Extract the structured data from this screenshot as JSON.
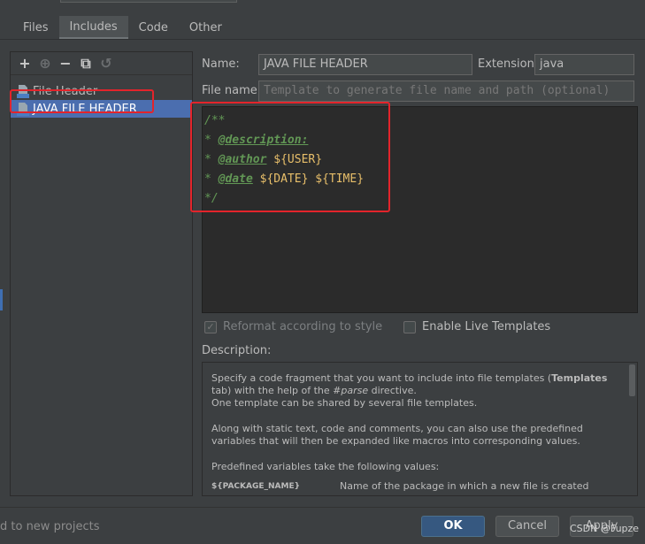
{
  "tabs": [
    {
      "label": "Files"
    },
    {
      "label": "Includes"
    },
    {
      "label": "Code"
    },
    {
      "label": "Other"
    }
  ],
  "toolbar": {
    "add": "+",
    "add_child": "⊕",
    "remove": "−",
    "copy": "⧉",
    "reset": "↺"
  },
  "templates": [
    {
      "label": "File Header"
    },
    {
      "label": "JAVA FILE HEADER"
    }
  ],
  "form": {
    "name_label": "Name:",
    "name_value": "JAVA FILE HEADER",
    "extension_label": "Extension:",
    "extension_value": "java",
    "filename_label": "File name:",
    "filename_placeholder": "Template to generate file name and path (optional)"
  },
  "editor": {
    "line1": "/**",
    "line2_star": "* ",
    "line2_tag": "@description:",
    "line3_star": "* ",
    "line3_tag": "@author",
    "line3_var": " ${USER}",
    "line4_star": "* ",
    "line4_tag": "@date",
    "line4_var1": " ${DATE}",
    "line4_var2": " ${TIME}",
    "line5": "*/"
  },
  "options": {
    "reformat_label": "Reformat according to style",
    "reformat_checked": true,
    "live_templates_label": "Enable Live Templates",
    "live_templates_checked": false
  },
  "description": {
    "label": "Description:",
    "p1_a": "Specify a code fragment that you want to include into file templates (",
    "p1_b": "Templates",
    "p1_c": " tab) with the help of the ",
    "p1_d": "#parse",
    "p1_e": " directive.",
    "p1_f": "One template can be shared by several file templates.",
    "p2": "Along with static text, code and comments, you can also use the predefined variables that will then be expanded like macros into corresponding values.",
    "p3": "Predefined variables take the following values:",
    "var_name": "${PACKAGE_NAME}",
    "var_desc": "Name of the package in which a new file is created"
  },
  "footer": {
    "left_text": "d to new projects",
    "ok": "OK",
    "cancel": "Cancel",
    "apply": "Apply",
    "watermark": "CSDN @Fupze"
  },
  "colors": {
    "background": "#3c3f41",
    "editor_bg": "#2b2b2b",
    "selection": "#4b6eaf",
    "highlight_box": "#e3242b",
    "comment": "#629755",
    "template_var": "#e8bf6a"
  }
}
